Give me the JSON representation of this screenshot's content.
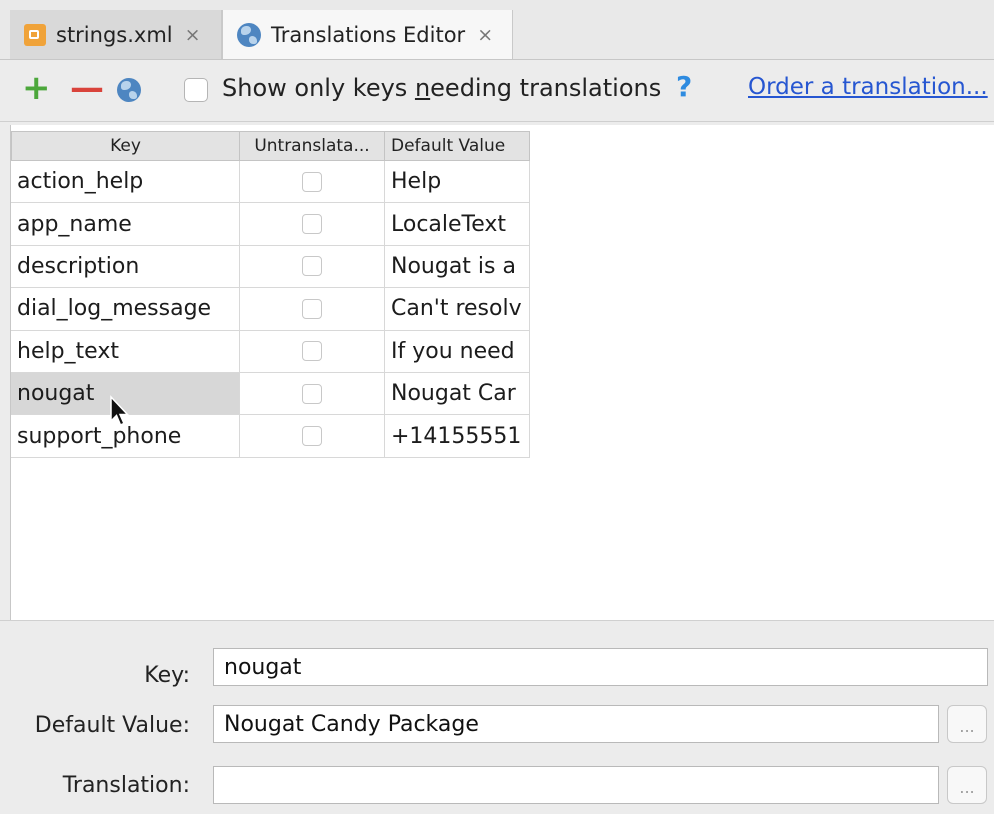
{
  "tabs": [
    {
      "label": "strings.xml",
      "icon": "xml-file-icon",
      "close": "×"
    },
    {
      "label": "Translations Editor",
      "icon": "globe-icon",
      "close": "×"
    }
  ],
  "toolbar": {
    "add_label": "+",
    "remove_label": "—",
    "show_only_prefix": "Show only keys ",
    "show_only_underlined": "n",
    "show_only_suffix": "eeding translations",
    "help_label": "?",
    "order_link": "Order a translation..."
  },
  "table": {
    "headers": [
      "Key",
      "Untranslata...",
      "Default Value"
    ],
    "rows": [
      {
        "key": "action_help",
        "untranslatable": false,
        "default": "Help"
      },
      {
        "key": "app_name",
        "untranslatable": false,
        "default": "LocaleText"
      },
      {
        "key": "description",
        "untranslatable": false,
        "default": "Nougat is a"
      },
      {
        "key": "dial_log_message",
        "untranslatable": false,
        "default": "Can't resolv"
      },
      {
        "key": "help_text",
        "untranslatable": false,
        "default": "If you need"
      },
      {
        "key": "nougat",
        "untranslatable": false,
        "default": "Nougat Car"
      },
      {
        "key": "support_phone",
        "untranslatable": false,
        "default": "+14155551"
      }
    ],
    "selected_row": "nougat"
  },
  "detail": {
    "key_label": "Key:",
    "key_value": "nougat",
    "default_label": "Default Value:",
    "default_value": "Nougat Candy Package",
    "translation_label": "Translation:",
    "translation_value": "",
    "ellipsis": "..."
  },
  "colors": {
    "add": "#4ca73b",
    "remove": "#d9433b",
    "link": "#2656d1",
    "help": "#2e8be0"
  }
}
